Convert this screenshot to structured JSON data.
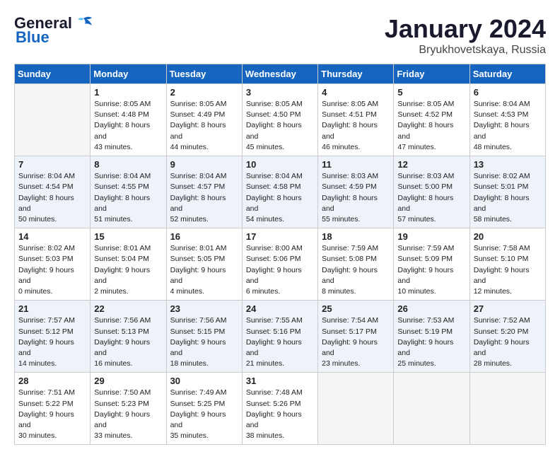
{
  "header": {
    "logo_line1": "General",
    "logo_line2": "Blue",
    "month": "January 2024",
    "location": "Bryukhovetskaya, Russia"
  },
  "days_of_week": [
    "Sunday",
    "Monday",
    "Tuesday",
    "Wednesday",
    "Thursday",
    "Friday",
    "Saturday"
  ],
  "weeks": [
    [
      {
        "day": "",
        "sunrise": "",
        "sunset": "",
        "daylight": "",
        "empty": true
      },
      {
        "day": "1",
        "sunrise": "Sunrise: 8:05 AM",
        "sunset": "Sunset: 4:48 PM",
        "daylight": "Daylight: 8 hours and 43 minutes."
      },
      {
        "day": "2",
        "sunrise": "Sunrise: 8:05 AM",
        "sunset": "Sunset: 4:49 PM",
        "daylight": "Daylight: 8 hours and 44 minutes."
      },
      {
        "day": "3",
        "sunrise": "Sunrise: 8:05 AM",
        "sunset": "Sunset: 4:50 PM",
        "daylight": "Daylight: 8 hours and 45 minutes."
      },
      {
        "day": "4",
        "sunrise": "Sunrise: 8:05 AM",
        "sunset": "Sunset: 4:51 PM",
        "daylight": "Daylight: 8 hours and 46 minutes."
      },
      {
        "day": "5",
        "sunrise": "Sunrise: 8:05 AM",
        "sunset": "Sunset: 4:52 PM",
        "daylight": "Daylight: 8 hours and 47 minutes."
      },
      {
        "day": "6",
        "sunrise": "Sunrise: 8:04 AM",
        "sunset": "Sunset: 4:53 PM",
        "daylight": "Daylight: 8 hours and 48 minutes."
      }
    ],
    [
      {
        "day": "7",
        "sunrise": "Sunrise: 8:04 AM",
        "sunset": "Sunset: 4:54 PM",
        "daylight": "Daylight: 8 hours and 50 minutes."
      },
      {
        "day": "8",
        "sunrise": "Sunrise: 8:04 AM",
        "sunset": "Sunset: 4:55 PM",
        "daylight": "Daylight: 8 hours and 51 minutes."
      },
      {
        "day": "9",
        "sunrise": "Sunrise: 8:04 AM",
        "sunset": "Sunset: 4:57 PM",
        "daylight": "Daylight: 8 hours and 52 minutes."
      },
      {
        "day": "10",
        "sunrise": "Sunrise: 8:04 AM",
        "sunset": "Sunset: 4:58 PM",
        "daylight": "Daylight: 8 hours and 54 minutes."
      },
      {
        "day": "11",
        "sunrise": "Sunrise: 8:03 AM",
        "sunset": "Sunset: 4:59 PM",
        "daylight": "Daylight: 8 hours and 55 minutes."
      },
      {
        "day": "12",
        "sunrise": "Sunrise: 8:03 AM",
        "sunset": "Sunset: 5:00 PM",
        "daylight": "Daylight: 8 hours and 57 minutes."
      },
      {
        "day": "13",
        "sunrise": "Sunrise: 8:02 AM",
        "sunset": "Sunset: 5:01 PM",
        "daylight": "Daylight: 8 hours and 58 minutes."
      }
    ],
    [
      {
        "day": "14",
        "sunrise": "Sunrise: 8:02 AM",
        "sunset": "Sunset: 5:03 PM",
        "daylight": "Daylight: 9 hours and 0 minutes."
      },
      {
        "day": "15",
        "sunrise": "Sunrise: 8:01 AM",
        "sunset": "Sunset: 5:04 PM",
        "daylight": "Daylight: 9 hours and 2 minutes."
      },
      {
        "day": "16",
        "sunrise": "Sunrise: 8:01 AM",
        "sunset": "Sunset: 5:05 PM",
        "daylight": "Daylight: 9 hours and 4 minutes."
      },
      {
        "day": "17",
        "sunrise": "Sunrise: 8:00 AM",
        "sunset": "Sunset: 5:06 PM",
        "daylight": "Daylight: 9 hours and 6 minutes."
      },
      {
        "day": "18",
        "sunrise": "Sunrise: 7:59 AM",
        "sunset": "Sunset: 5:08 PM",
        "daylight": "Daylight: 9 hours and 8 minutes."
      },
      {
        "day": "19",
        "sunrise": "Sunrise: 7:59 AM",
        "sunset": "Sunset: 5:09 PM",
        "daylight": "Daylight: 9 hours and 10 minutes."
      },
      {
        "day": "20",
        "sunrise": "Sunrise: 7:58 AM",
        "sunset": "Sunset: 5:10 PM",
        "daylight": "Daylight: 9 hours and 12 minutes."
      }
    ],
    [
      {
        "day": "21",
        "sunrise": "Sunrise: 7:57 AM",
        "sunset": "Sunset: 5:12 PM",
        "daylight": "Daylight: 9 hours and 14 minutes."
      },
      {
        "day": "22",
        "sunrise": "Sunrise: 7:56 AM",
        "sunset": "Sunset: 5:13 PM",
        "daylight": "Daylight: 9 hours and 16 minutes."
      },
      {
        "day": "23",
        "sunrise": "Sunrise: 7:56 AM",
        "sunset": "Sunset: 5:15 PM",
        "daylight": "Daylight: 9 hours and 18 minutes."
      },
      {
        "day": "24",
        "sunrise": "Sunrise: 7:55 AM",
        "sunset": "Sunset: 5:16 PM",
        "daylight": "Daylight: 9 hours and 21 minutes."
      },
      {
        "day": "25",
        "sunrise": "Sunrise: 7:54 AM",
        "sunset": "Sunset: 5:17 PM",
        "daylight": "Daylight: 9 hours and 23 minutes."
      },
      {
        "day": "26",
        "sunrise": "Sunrise: 7:53 AM",
        "sunset": "Sunset: 5:19 PM",
        "daylight": "Daylight: 9 hours and 25 minutes."
      },
      {
        "day": "27",
        "sunrise": "Sunrise: 7:52 AM",
        "sunset": "Sunset: 5:20 PM",
        "daylight": "Daylight: 9 hours and 28 minutes."
      }
    ],
    [
      {
        "day": "28",
        "sunrise": "Sunrise: 7:51 AM",
        "sunset": "Sunset: 5:22 PM",
        "daylight": "Daylight: 9 hours and 30 minutes."
      },
      {
        "day": "29",
        "sunrise": "Sunrise: 7:50 AM",
        "sunset": "Sunset: 5:23 PM",
        "daylight": "Daylight: 9 hours and 33 minutes."
      },
      {
        "day": "30",
        "sunrise": "Sunrise: 7:49 AM",
        "sunset": "Sunset: 5:25 PM",
        "daylight": "Daylight: 9 hours and 35 minutes."
      },
      {
        "day": "31",
        "sunrise": "Sunrise: 7:48 AM",
        "sunset": "Sunset: 5:26 PM",
        "daylight": "Daylight: 9 hours and 38 minutes."
      },
      {
        "day": "",
        "sunrise": "",
        "sunset": "",
        "daylight": "",
        "empty": true
      },
      {
        "day": "",
        "sunrise": "",
        "sunset": "",
        "daylight": "",
        "empty": true
      },
      {
        "day": "",
        "sunrise": "",
        "sunset": "",
        "daylight": "",
        "empty": true
      }
    ]
  ]
}
